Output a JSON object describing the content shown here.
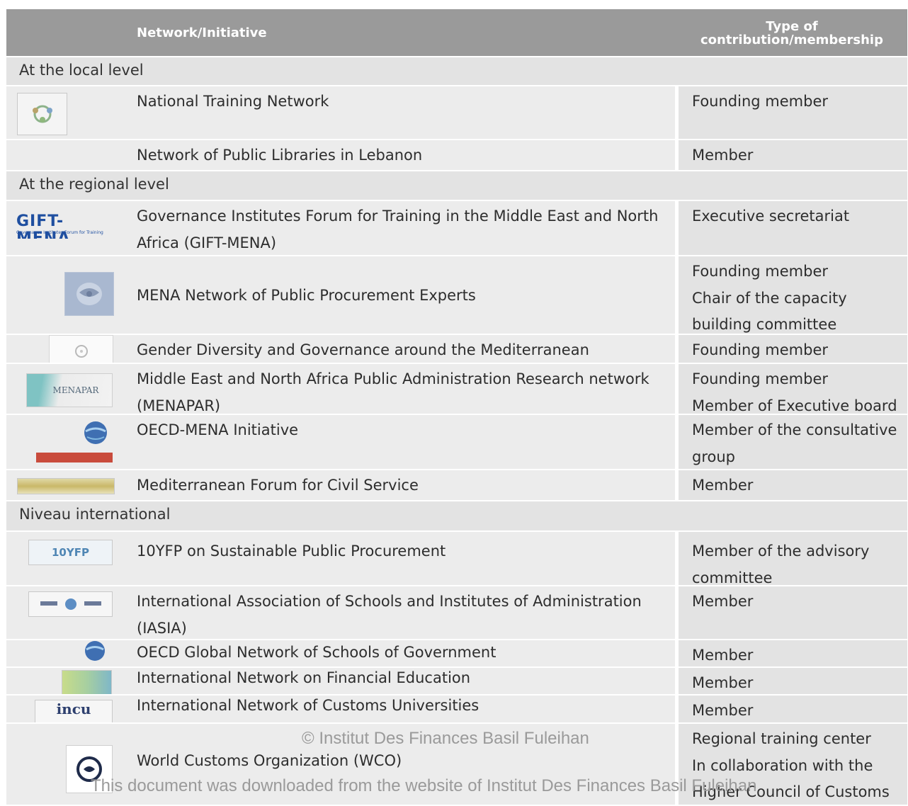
{
  "header": {
    "network_col": "Network/Initiative",
    "type_col": "Type of contribution/membership"
  },
  "sections": {
    "local": "At the local level",
    "regional": "At the regional level",
    "international": "Niveau international"
  },
  "rows": {
    "ntn": {
      "name": "National Training Network",
      "type": "Founding member",
      "logo": "national-training-network-logo"
    },
    "libraries": {
      "name": "Network of Public Libraries in Lebanon",
      "type": "Member"
    },
    "gift": {
      "name": "Governance Institutes Forum for Training in the Middle East and North Africa (GIFT-MENA)",
      "type": "Executive secretariat",
      "logo_text": "GIFT-MENA",
      "logo_subtext": "Governance Institutes Forum for Training"
    },
    "procurement": {
      "name": "MENA Network of Public Procurement Experts",
      "type_lines": [
        "Founding member",
        "Chair of the capacity",
        "building committee"
      ]
    },
    "gender": {
      "name": "Gender Diversity and Governance around the Mediterranean",
      "type": "Founding member"
    },
    "menapar": {
      "name": "Middle East and North Africa Public Administration Research network (MENAPAR)",
      "type_lines": [
        "Founding member",
        "Member of Executive board"
      ],
      "logo_text": "MENAPAR"
    },
    "oecd_mena": {
      "name": "OECD-MENA Initiative",
      "type": "Member of the consultative group"
    },
    "civil_service": {
      "name": "Mediterranean Forum for Civil Service",
      "type": "Member"
    },
    "yfp": {
      "name": "10YFP on Sustainable Public Procurement",
      "type": "Member of the advisory committee",
      "logo_text": "10YFP"
    },
    "iasia": {
      "name": "International Association of Schools and Institutes of Administration (IASIA)",
      "type": "Member"
    },
    "oecd_gov": {
      "name": "OECD Global Network of Schools of Government",
      "type": "Member"
    },
    "infe": {
      "name": "International Network on Financial Education",
      "type": "Member"
    },
    "incu": {
      "name": "International Network of Customs Universities",
      "type": "Member",
      "logo_text": "incu"
    },
    "wco": {
      "name": "World Customs Organization (WCO)",
      "type_lines": [
        "Regional training center",
        "In collaboration with the",
        "Higher Council of Customs"
      ]
    }
  },
  "watermark": {
    "line1": "© Institut Des Finances Basil Fuleihan",
    "line2": "This document was downloaded from the website of Institut Des Finances Basil Fuleihan"
  },
  "colors": {
    "header_bg": "#9a9a9a",
    "section_bg": "#e3e3e3",
    "row_bg": "#ececec",
    "gift_blue": "#1f4fa0",
    "gift_green": "#a8c83c"
  }
}
